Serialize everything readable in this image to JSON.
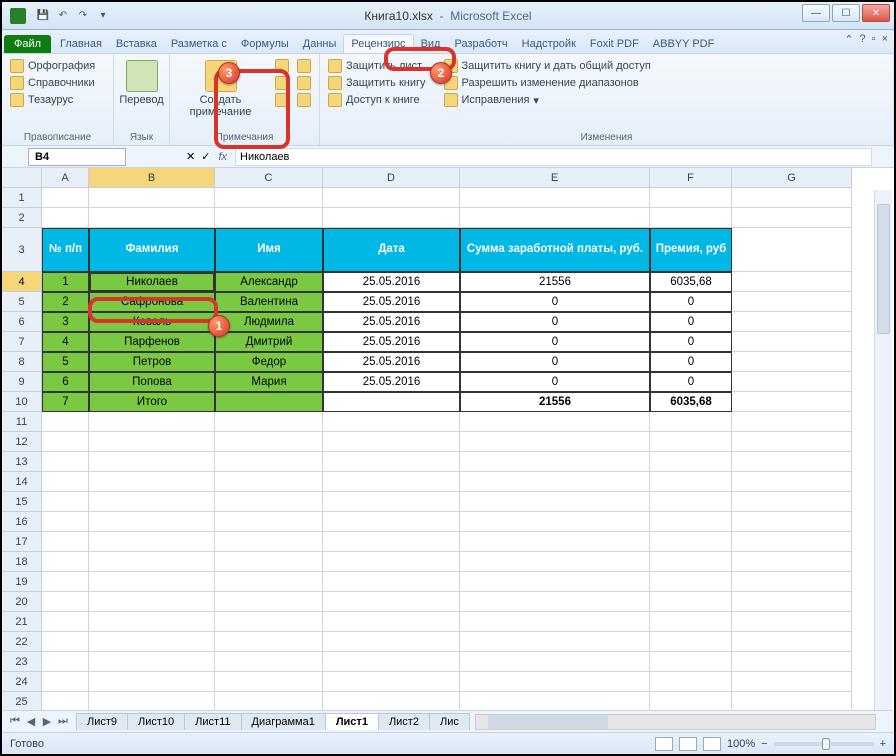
{
  "window": {
    "filename": "Книга10.xlsx",
    "app": "Microsoft Excel"
  },
  "tabs": {
    "file": "Файл",
    "items": [
      "Главная",
      "Вставка",
      "Разметка с",
      "Формулы",
      "Данны",
      "Рецензирс",
      "Вид",
      "Разработч",
      "Надстройк",
      "Foxit PDF",
      "ABBYY PDF"
    ],
    "active_index": 5
  },
  "ribbon": {
    "group_spell": {
      "label": "Правописание",
      "spelling": "Орфография",
      "reference": "Справочники",
      "thesaurus": "Тезаурус"
    },
    "group_lang": {
      "label": "Язык",
      "translate": "Перевод"
    },
    "group_comments": {
      "label": "Примечания",
      "new_comment": "Создать примечание"
    },
    "group_changes": {
      "label": "Изменения",
      "protect_sheet": "Защитить лист",
      "protect_book": "Защитить книгу",
      "share_book": "Доступ к книге",
      "protect_share": "Защитить книгу и дать общий доступ",
      "allow_ranges": "Разрешить изменение диапазонов",
      "track": "Исправления"
    }
  },
  "formula_bar": {
    "cell_ref": "B4",
    "fx": "fx",
    "value": "Николаев"
  },
  "columns": [
    "A",
    "B",
    "C",
    "D",
    "E",
    "F",
    "G"
  ],
  "selected_col": "B",
  "selected_row": 4,
  "table": {
    "headers": {
      "n": "№ п/п",
      "surname": "Фамилия",
      "name": "Имя",
      "date": "Дата",
      "salary": "Сумма заработной платы, руб.",
      "bonus": "Премия, руб"
    },
    "rows": [
      {
        "n": "1",
        "surname": "Николаев",
        "name": "Александр",
        "date": "25.05.2016",
        "salary": "21556",
        "bonus": "6035,68"
      },
      {
        "n": "2",
        "surname": "Сафронова",
        "name": "Валентина",
        "date": "25.05.2016",
        "salary": "0",
        "bonus": "0"
      },
      {
        "n": "3",
        "surname": "Коваль",
        "name": "Людмила",
        "date": "25.05.2016",
        "salary": "0",
        "bonus": "0"
      },
      {
        "n": "4",
        "surname": "Парфенов",
        "name": "Дмитрий",
        "date": "25.05.2016",
        "salary": "0",
        "bonus": "0"
      },
      {
        "n": "5",
        "surname": "Петров",
        "name": "Федор",
        "date": "25.05.2016",
        "salary": "0",
        "bonus": "0"
      },
      {
        "n": "6",
        "surname": "Попова",
        "name": "Мария",
        "date": "25.05.2016",
        "salary": "0",
        "bonus": "0"
      }
    ],
    "total": {
      "n": "7",
      "label": "Итого",
      "salary": "21556",
      "bonus": "6035,68"
    }
  },
  "sheets": {
    "items": [
      "Лист9",
      "Лист10",
      "Лист11",
      "Диаграмма1",
      "Лист1",
      "Лист2",
      "Лис"
    ],
    "active_index": 4
  },
  "status": {
    "ready": "Готово",
    "zoom": "100%"
  },
  "callouts": {
    "b1": "1",
    "b2": "2",
    "b3": "3"
  }
}
